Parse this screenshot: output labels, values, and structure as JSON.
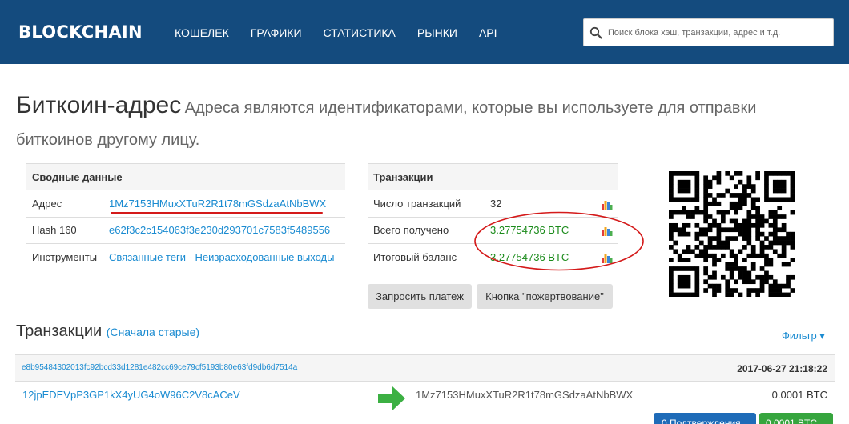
{
  "header": {
    "logo": "BLOCKCHAIN",
    "nav": [
      "КОШЕЛЕК",
      "ГРАФИКИ",
      "СТАТИСТИКА",
      "РЫНКИ",
      "API"
    ],
    "search_placeholder": "Поиск блока хэш, транзакции, адрес и т.д."
  },
  "page": {
    "title": "Биткоин-адрес",
    "subtitle": "Адреса являются идентификаторами, которые вы используете для отправки биткоинов другому лицу."
  },
  "summary": {
    "heading": "Сводные данные",
    "address_label": "Адрес",
    "address_value": "1Mz7153HMuxXTuR2R1t78mGSdzaAtNbBWX",
    "hash_label": "Hash 160",
    "hash_value": "e62f3c2c154063f3e230d293701c7583f5489556",
    "tools_label": "Инструменты",
    "tools_value": "Связанные теги - Неизрасходованные выходы"
  },
  "transactions_summary": {
    "heading": "Транзакции",
    "count_label": "Число транзакций",
    "count_value": "32",
    "received_label": "Всего получено",
    "received_value": "3.27754736 BTC",
    "balance_label": "Итоговый баланс",
    "balance_value": "3.27754736 BTC"
  },
  "buttons": {
    "request_payment": "Запросить платеж",
    "donation": "Кнопка \"пожертвование\""
  },
  "tx_section": {
    "title": "Транзакции",
    "sort": "(Сначала старые)",
    "filter": "Фильтр ▾",
    "items": [
      {
        "hash": "e8b95484302013fc92bcd33d1281e482cc69ce79cf5193b80e63fd9db6d7514a",
        "time": "2017-06-27 21:18:22",
        "from": "12jpEDEVpP3GP1kX4yUG4oW96C2V8cACeV",
        "to": "1Mz7153HMuxXTuR2R1t78mGSdzaAtNbBWX",
        "amount": "0.0001 BTC",
        "confirmations": "0 Подтверждения",
        "btc_badge": "0.0001 BTC"
      }
    ]
  },
  "icons": {
    "search": "search-icon",
    "chart": "bar-chart-icon",
    "arrow": "arrow-right-icon",
    "qr": "qr-code-icon"
  },
  "colors": {
    "header_bg": "#144b7e",
    "link": "#1a8bd1",
    "btc_green": "#1b8b1b",
    "annotation_red": "#d41a1a"
  }
}
